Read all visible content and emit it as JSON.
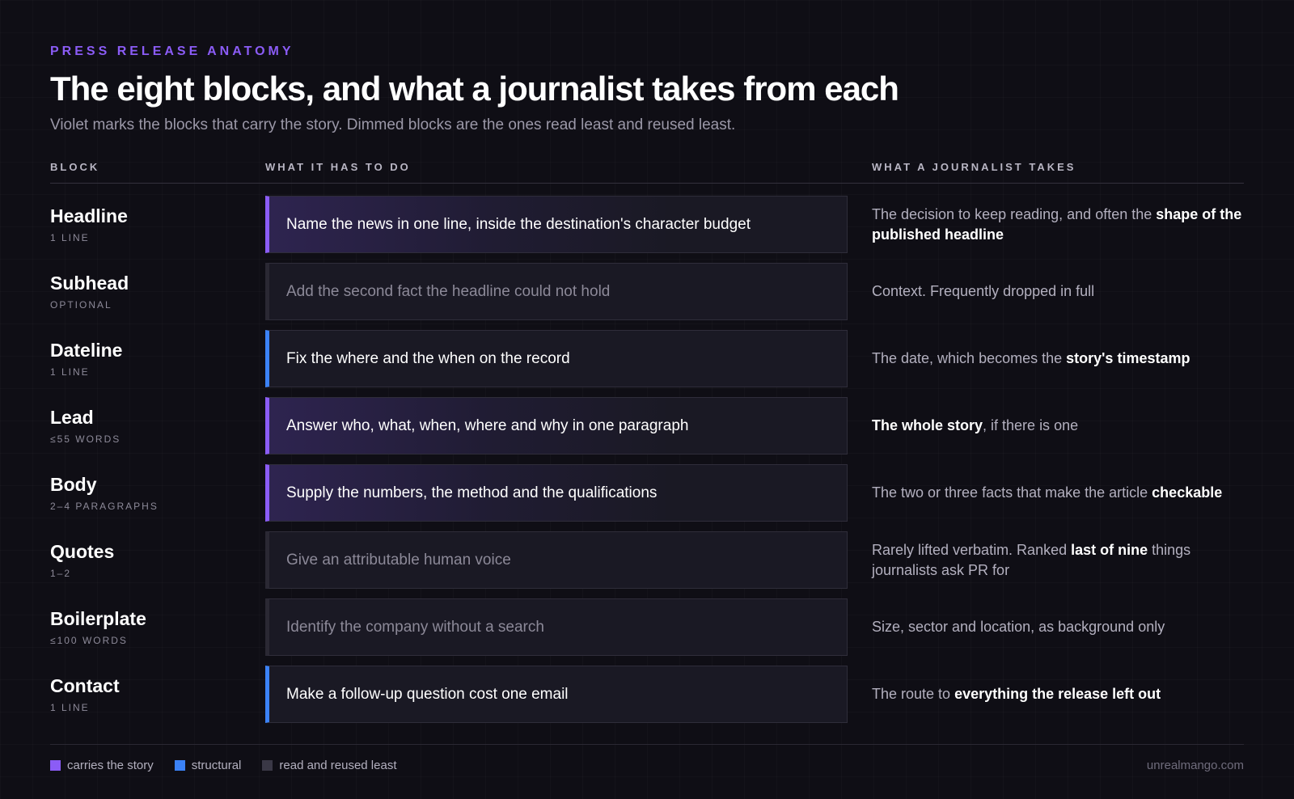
{
  "header": {
    "eyebrow": "PRESS RELEASE ANATOMY",
    "title": "The eight blocks, and what a journalist takes from each",
    "subtitle": "Violet marks the blocks that carry the story. Dimmed blocks are the ones read least and reused least."
  },
  "columns": {
    "block": "BLOCK",
    "task": "WHAT IT HAS TO DO",
    "takes": "WHAT A JOURNALIST TAKES"
  },
  "colors": {
    "story": "#8b5cf6",
    "structural": "#3b82f6",
    "dim": "#3a3846"
  },
  "rows": [
    {
      "name": "Headline",
      "meta": "1 LINE",
      "kind": "story",
      "task": "Name the news in one line, inside the destination's character budget",
      "take": [
        {
          "t": "The decision to keep reading, and often the ",
          "b": false
        },
        {
          "t": "shape of the published headline",
          "b": true
        }
      ]
    },
    {
      "name": "Subhead",
      "meta": "OPTIONAL",
      "kind": "dim",
      "task": "Add the second fact the headline could not hold",
      "take": [
        {
          "t": "Context. Frequently dropped in full",
          "b": false
        }
      ]
    },
    {
      "name": "Dateline",
      "meta": "1 LINE",
      "kind": "structural",
      "task": "Fix the where and the when on the record",
      "take": [
        {
          "t": "The date, which becomes the ",
          "b": false
        },
        {
          "t": "story's timestamp",
          "b": true
        }
      ]
    },
    {
      "name": "Lead",
      "meta": "≤55 WORDS",
      "kind": "story",
      "task": "Answer who, what, when, where and why in one paragraph",
      "take": [
        {
          "t": "The whole story",
          "b": true
        },
        {
          "t": ", if there is one",
          "b": false
        }
      ]
    },
    {
      "name": "Body",
      "meta": "2–4 PARAGRAPHS",
      "kind": "story",
      "task": "Supply the numbers, the method and the qualifications",
      "take": [
        {
          "t": "The two or three facts that make the article ",
          "b": false
        },
        {
          "t": "checkable",
          "b": true
        }
      ]
    },
    {
      "name": "Quotes",
      "meta": "1–2",
      "kind": "dim",
      "task": "Give an attributable human voice",
      "take": [
        {
          "t": "Rarely lifted verbatim. Ranked ",
          "b": false
        },
        {
          "t": "last of nine",
          "b": true
        },
        {
          "t": " things journalists ask PR for",
          "b": false
        }
      ]
    },
    {
      "name": "Boilerplate",
      "meta": "≤100 WORDS",
      "kind": "dim",
      "task": "Identify the company without a search",
      "take": [
        {
          "t": "Size, sector and location, as background only",
          "b": false
        }
      ]
    },
    {
      "name": "Contact",
      "meta": "1 LINE",
      "kind": "structural",
      "task": "Make a follow-up question cost one email",
      "take": [
        {
          "t": "The route to ",
          "b": false
        },
        {
          "t": "everything the release left out",
          "b": true
        }
      ]
    }
  ],
  "legend": [
    {
      "label": "carries the story",
      "color": "#8b5cf6"
    },
    {
      "label": "structural",
      "color": "#3b82f6"
    },
    {
      "label": "read and reused least",
      "color": "#3a3846"
    }
  ],
  "credit": "unrealmango.com"
}
